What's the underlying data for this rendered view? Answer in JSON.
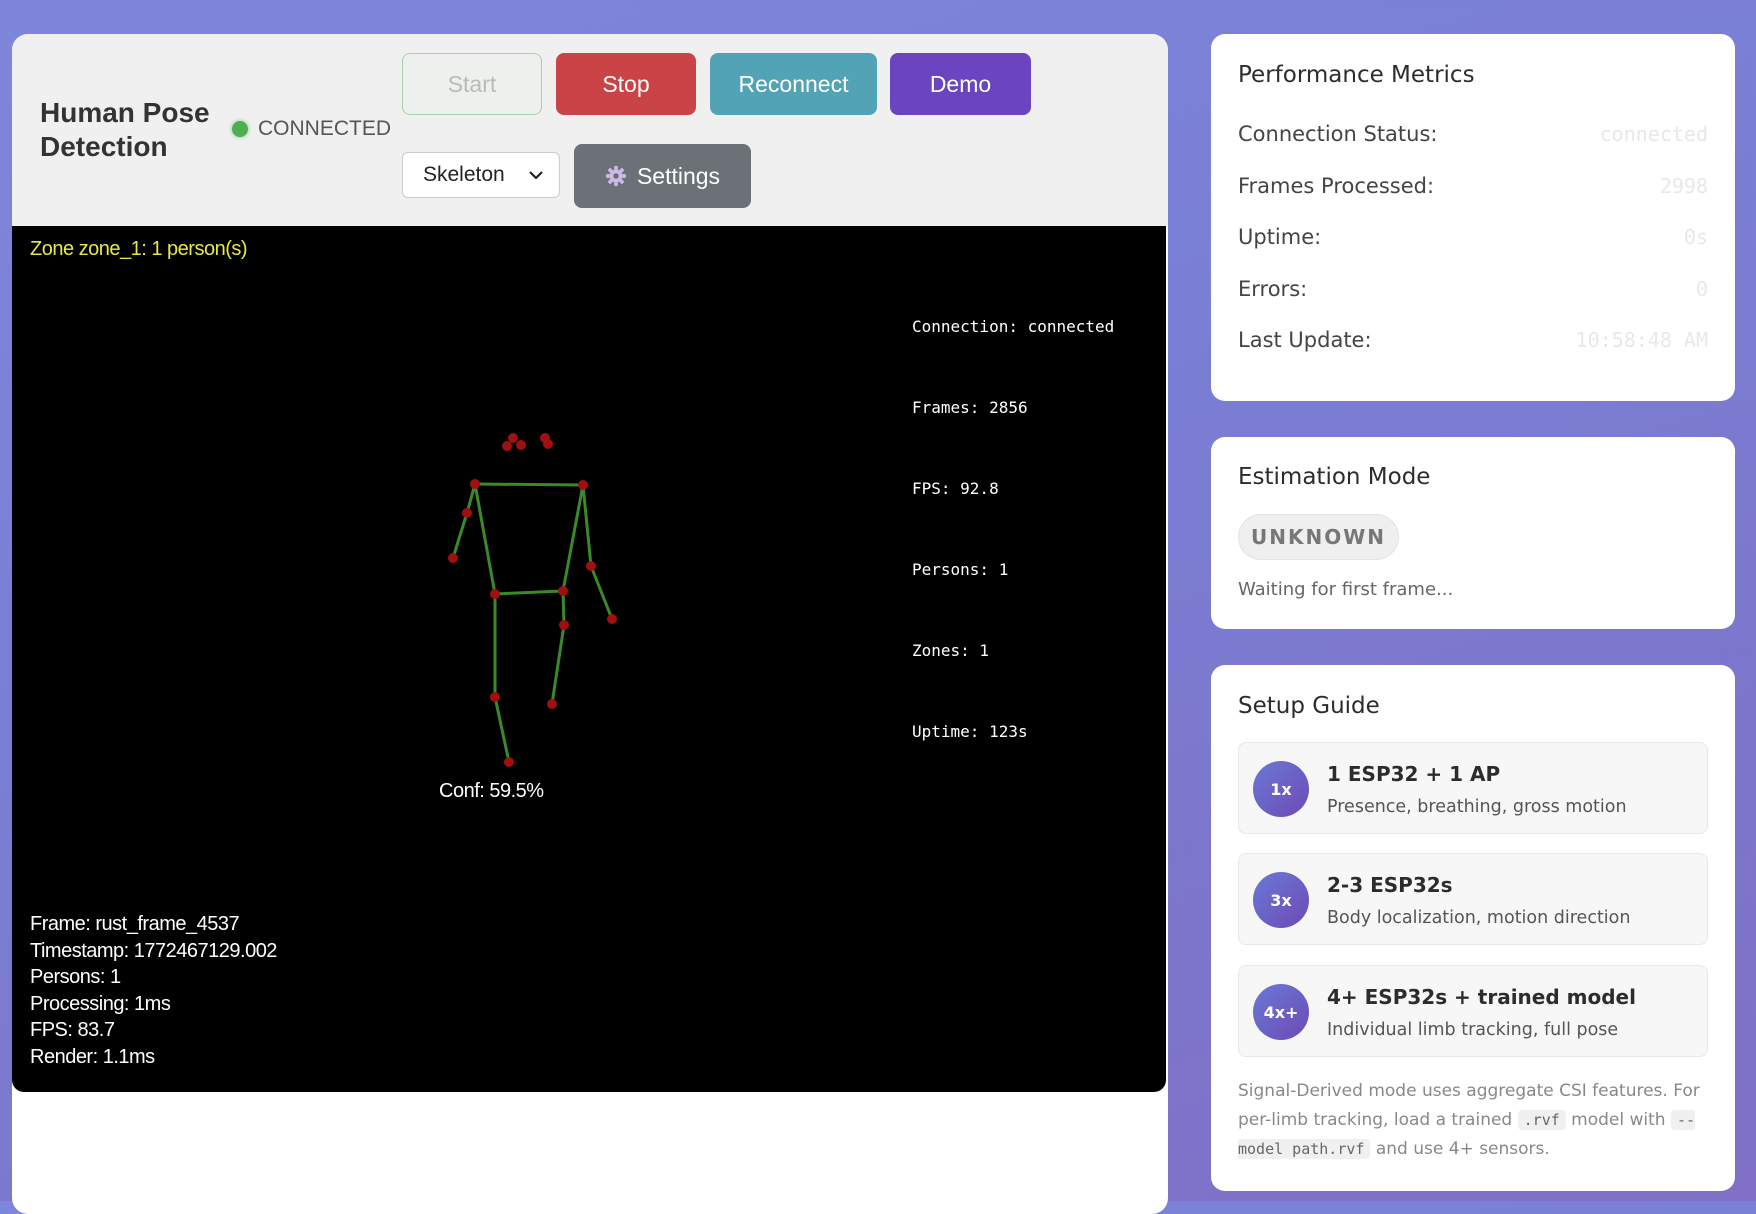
{
  "app": {
    "title": "Human Pose Detection",
    "status": "CONNECTED",
    "status_color": "#4caf50"
  },
  "controls": {
    "start_label": "Start",
    "stop_label": "Stop",
    "reconnect_label": "Reconnect",
    "demo_label": "Demo",
    "mode_value": "Skeleton",
    "settings_label": "Settings"
  },
  "canvas": {
    "zone_label": "Zone zone_1: 1 person(s)",
    "stats": [
      "Connection: connected",
      "Frames: 2856",
      "FPS: 92.8",
      "Persons: 1",
      "Zones: 1",
      "Uptime: 123s"
    ],
    "frame_info": [
      "Frame: rust_frame_4537",
      "Timestamp: 1772467129.002",
      "Persons: 1",
      "Processing: 1ms",
      "FPS: 83.7",
      "Render: 1.1ms"
    ],
    "confidence_label": "Conf: 59.5%",
    "skeleton_color": "#3a8a2a",
    "joint_color": "#a01010"
  },
  "metrics": {
    "title": "Performance Metrics",
    "rows": [
      {
        "label": "Connection Status:",
        "value": "connected"
      },
      {
        "label": "Frames Processed:",
        "value": "2998"
      },
      {
        "label": "Uptime:",
        "value": "0s"
      },
      {
        "label": "Errors:",
        "value": "0"
      },
      {
        "label": "Last Update:",
        "value": "10:58:48 AM"
      }
    ]
  },
  "estimation": {
    "title": "Estimation Mode",
    "badge": "UNKNOWN",
    "status_text": "Waiting for first frame..."
  },
  "setup": {
    "title": "Setup Guide",
    "items": [
      {
        "icon": "1x",
        "title": "1 ESP32 + 1 AP",
        "desc": "Presence, breathing, gross motion"
      },
      {
        "icon": "3x",
        "title": "2-3 ESP32s",
        "desc": "Body localization, motion direction"
      },
      {
        "icon": "4x+",
        "title": "4+ ESP32s + trained model",
        "desc": "Individual limb tracking, full pose"
      }
    ],
    "note_part1": "Signal-Derived mode uses aggregate CSI features. For per-limb tracking, load a trained",
    "note_code1": ".rvf",
    "note_part2": "model with",
    "note_code2": "--model path.rvf",
    "note_part3": "and use 4+ sensors."
  }
}
